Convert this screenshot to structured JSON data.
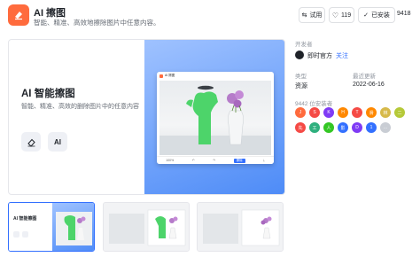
{
  "app": {
    "title": "AI 擦图",
    "subtitle": "智能、精准、高效地擦除图片中任意内容。",
    "icon": "eraser-icon",
    "brand_color": "#ff6b3d"
  },
  "actions": {
    "try_label": "试用",
    "like_count": "119",
    "installed_label": "已安装",
    "install_count": "9418"
  },
  "hero": {
    "title": "AI 智能擦图",
    "desc": "智能、精准、高效的删除图片中的任意内容",
    "ai_label": "AI",
    "window_title": "AI 擦图",
    "zoom": "100%",
    "toolbar_btn": "擦除"
  },
  "sidebar": {
    "developer_label": "开发者",
    "developer_name": "即时官方",
    "follow_label": "关注",
    "type_label": "类型",
    "type_value": "资源",
    "updated_label": "最近更新",
    "updated_value": "2022-06-16",
    "users_label": "9442 位安装者",
    "avatars": [
      {
        "text": "J",
        "color": "#ff6b3d"
      },
      {
        "text": "S",
        "color": "#f54a45"
      },
      {
        "text": "K",
        "color": "#7f3bf5"
      },
      {
        "text": "H",
        "color": "#ff8800"
      },
      {
        "text": "T",
        "color": "#f54a45"
      },
      {
        "text": "滑",
        "color": "#ff8800"
      },
      {
        "text": "林",
        "color": "#d6b94a"
      },
      {
        "text": "二",
        "color": "#b5c938"
      },
      {
        "text": "先",
        "color": "#f54a45"
      },
      {
        "text": "工",
        "color": "#2fb07e"
      },
      {
        "text": "人",
        "color": "#34c724"
      },
      {
        "text": "影",
        "color": "#3370ff"
      },
      {
        "text": "D",
        "color": "#7f3bf5"
      },
      {
        "text": "1",
        "color": "#3370ff"
      },
      {
        "text": "…",
        "color": "#c9cdd4"
      }
    ]
  },
  "thumbnails": [
    {
      "title": "AI 智能擦图"
    },
    {
      "title": ""
    },
    {
      "title": ""
    }
  ]
}
